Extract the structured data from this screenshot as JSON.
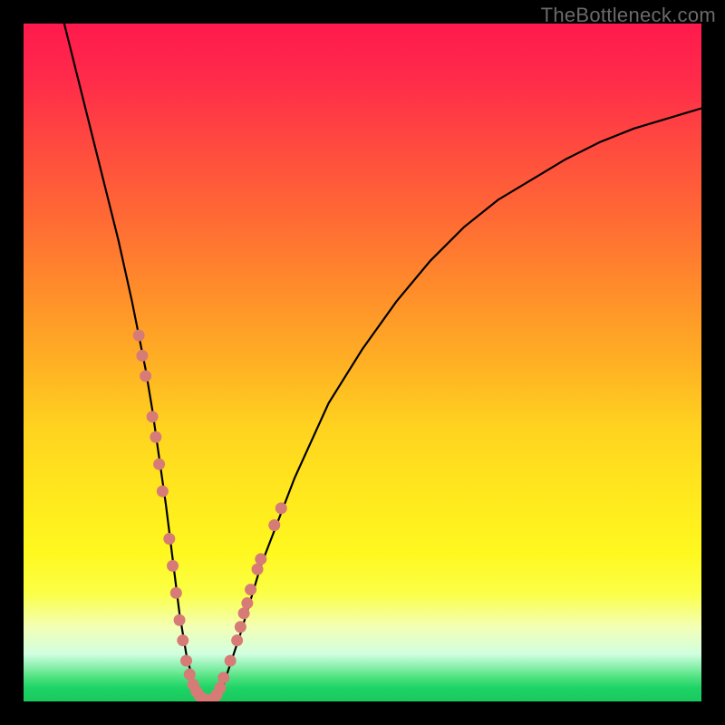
{
  "watermark": "TheBottleneck.com",
  "chart_data": {
    "type": "line",
    "title": "",
    "xlabel": "",
    "ylabel": "",
    "xlim": [
      0,
      100
    ],
    "ylim": [
      0,
      100
    ],
    "grid": false,
    "legend": false,
    "curve": {
      "name": "bottleneck-curve",
      "x": [
        6,
        8,
        10,
        12,
        14,
        16,
        17,
        18,
        19,
        20,
        21,
        22,
        23,
        24,
        25,
        26,
        27,
        28,
        29,
        30,
        32,
        35,
        40,
        45,
        50,
        55,
        60,
        65,
        70,
        75,
        80,
        85,
        90,
        95,
        100
      ],
      "y": [
        100,
        92,
        84,
        76,
        68,
        59,
        54,
        49,
        43,
        36,
        29,
        21,
        13,
        7,
        3,
        1,
        0,
        0,
        1,
        4,
        10,
        20,
        33,
        44,
        52,
        59,
        65,
        70,
        74,
        77,
        80,
        82.5,
        84.5,
        86,
        87.5
      ]
    },
    "dots": {
      "name": "sample-points",
      "color": "#d77b76",
      "points": [
        {
          "x": 17.0,
          "y": 54
        },
        {
          "x": 17.5,
          "y": 51
        },
        {
          "x": 18.0,
          "y": 48
        },
        {
          "x": 19.0,
          "y": 42
        },
        {
          "x": 19.5,
          "y": 39
        },
        {
          "x": 20.0,
          "y": 35
        },
        {
          "x": 20.5,
          "y": 31
        },
        {
          "x": 21.5,
          "y": 24
        },
        {
          "x": 22.0,
          "y": 20
        },
        {
          "x": 22.5,
          "y": 16
        },
        {
          "x": 23.0,
          "y": 12
        },
        {
          "x": 23.5,
          "y": 9
        },
        {
          "x": 24.0,
          "y": 6
        },
        {
          "x": 24.5,
          "y": 4
        },
        {
          "x": 25.0,
          "y": 2.5
        },
        {
          "x": 25.5,
          "y": 1.5
        },
        {
          "x": 26.0,
          "y": 0.8
        },
        {
          "x": 26.5,
          "y": 0.4
        },
        {
          "x": 27.0,
          "y": 0.2
        },
        {
          "x": 27.5,
          "y": 0.2
        },
        {
          "x": 28.0,
          "y": 0.4
        },
        {
          "x": 28.5,
          "y": 1
        },
        {
          "x": 29.0,
          "y": 2
        },
        {
          "x": 29.5,
          "y": 3.5
        },
        {
          "x": 30.5,
          "y": 6
        },
        {
          "x": 31.5,
          "y": 9
        },
        {
          "x": 32.0,
          "y": 11
        },
        {
          "x": 32.5,
          "y": 13
        },
        {
          "x": 33.0,
          "y": 14.5
        },
        {
          "x": 33.5,
          "y": 16.5
        },
        {
          "x": 34.5,
          "y": 19.5
        },
        {
          "x": 35.0,
          "y": 21
        },
        {
          "x": 37.0,
          "y": 26
        },
        {
          "x": 38.0,
          "y": 28.5
        }
      ]
    },
    "gradient_stops": [
      {
        "pos": 0,
        "color": "#ff1a4d"
      },
      {
        "pos": 0.18,
        "color": "#ff4a3f"
      },
      {
        "pos": 0.4,
        "color": "#ff8f2a"
      },
      {
        "pos": 0.6,
        "color": "#ffd41f"
      },
      {
        "pos": 0.78,
        "color": "#fff81f"
      },
      {
        "pos": 0.93,
        "color": "#d1ffe0"
      },
      {
        "pos": 1.0,
        "color": "#19c85e"
      }
    ]
  }
}
